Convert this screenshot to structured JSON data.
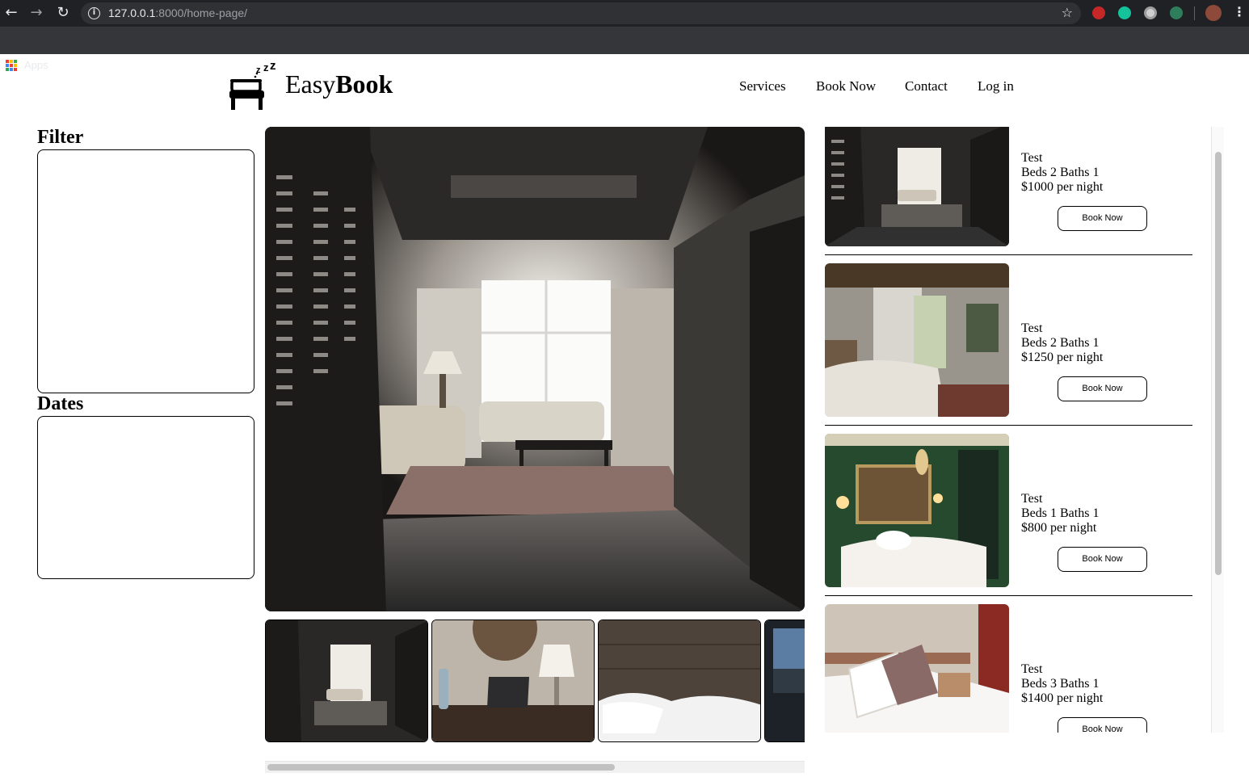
{
  "browser": {
    "url_host": "127.0.0.1",
    "url_rest": ":8000/home-page/",
    "bookmarks_label": "Apps"
  },
  "header": {
    "brand_light": "Easy",
    "brand_bold": "Book",
    "nav": [
      "Services",
      "Book Now",
      "Contact",
      "Log in"
    ]
  },
  "sidebar": {
    "filter_title": "Filter",
    "dates_title": "Dates"
  },
  "listings": [
    {
      "title": "Test",
      "details": "Beds 2 Baths 1",
      "price": "$1000 per night",
      "button": "Book Now"
    },
    {
      "title": "Test",
      "details": "Beds 2 Baths 1",
      "price": "$1250 per night",
      "button": "Book Now"
    },
    {
      "title": "Test",
      "details": "Beds 1 Baths 1",
      "price": "$800 per night",
      "button": "Book Now"
    },
    {
      "title": "Test",
      "details": "Beds 3 Baths 1",
      "price": "$1400 per night",
      "button": "Book Now"
    }
  ],
  "icons": {
    "back": "arrow-left-icon",
    "forward": "arrow-right-icon",
    "reload": "reload-icon",
    "info": "info-icon",
    "bookmark": "star-icon",
    "menu": "more-vert-icon",
    "logo": "sleeping-bed-icon"
  },
  "colors": {
    "chrome_dark": "#202124",
    "bookmarks_bar": "#35363a",
    "page_bg": "#ffffff",
    "text": "#000000"
  }
}
